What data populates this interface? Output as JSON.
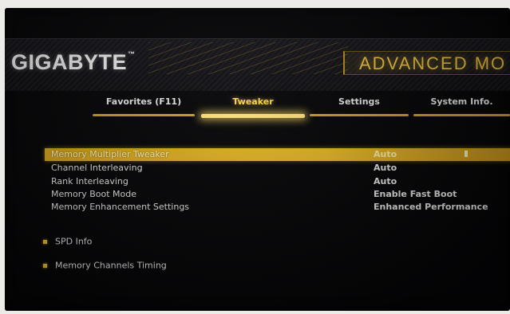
{
  "header": {
    "brand": "GIGABYTE",
    "brand_tm": "™",
    "mode_title": "ADVANCED MO"
  },
  "tabs": [
    {
      "label": "Favorites (F11)",
      "active": false
    },
    {
      "label": "Tweaker",
      "active": true
    },
    {
      "label": "Settings",
      "active": false
    },
    {
      "label": "System Info.",
      "active": false
    }
  ],
  "settings": [
    {
      "label": "Memory Multiplier Tweaker",
      "value": "Auto",
      "selected": true
    },
    {
      "label": "Channel Interleaving",
      "value": "Auto",
      "selected": false
    },
    {
      "label": "Rank Interleaving",
      "value": "Auto",
      "selected": false
    },
    {
      "label": "Memory Boot Mode",
      "value": "Enable Fast Boot",
      "selected": false
    },
    {
      "label": "Memory Enhancement Settings",
      "value": "Enhanced Performance",
      "selected": false
    }
  ],
  "submenus": [
    {
      "label": "SPD Info"
    },
    {
      "label": "Memory Channels Timing"
    }
  ],
  "colors": {
    "accent_gold": "#f0c23a",
    "selection_bar": "#e8b928",
    "screen_bg": "#050507"
  }
}
